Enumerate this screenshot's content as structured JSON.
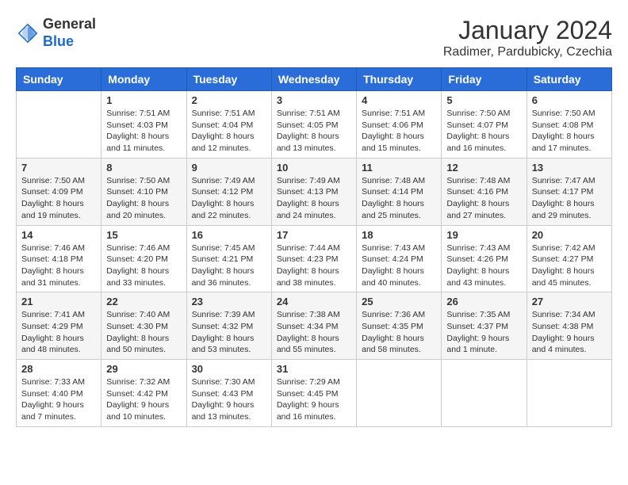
{
  "header": {
    "logo": {
      "line1": "General",
      "line2": "Blue"
    },
    "month_year": "January 2024",
    "location": "Radimer, Pardubicky, Czechia"
  },
  "days_of_week": [
    "Sunday",
    "Monday",
    "Tuesday",
    "Wednesday",
    "Thursday",
    "Friday",
    "Saturday"
  ],
  "weeks": [
    [
      {
        "day": "",
        "info": ""
      },
      {
        "day": "1",
        "info": "Sunrise: 7:51 AM\nSunset: 4:03 PM\nDaylight: 8 hours\nand 11 minutes."
      },
      {
        "day": "2",
        "info": "Sunrise: 7:51 AM\nSunset: 4:04 PM\nDaylight: 8 hours\nand 12 minutes."
      },
      {
        "day": "3",
        "info": "Sunrise: 7:51 AM\nSunset: 4:05 PM\nDaylight: 8 hours\nand 13 minutes."
      },
      {
        "day": "4",
        "info": "Sunrise: 7:51 AM\nSunset: 4:06 PM\nDaylight: 8 hours\nand 15 minutes."
      },
      {
        "day": "5",
        "info": "Sunrise: 7:50 AM\nSunset: 4:07 PM\nDaylight: 8 hours\nand 16 minutes."
      },
      {
        "day": "6",
        "info": "Sunrise: 7:50 AM\nSunset: 4:08 PM\nDaylight: 8 hours\nand 17 minutes."
      }
    ],
    [
      {
        "day": "7",
        "info": "Sunrise: 7:50 AM\nSunset: 4:09 PM\nDaylight: 8 hours\nand 19 minutes."
      },
      {
        "day": "8",
        "info": "Sunrise: 7:50 AM\nSunset: 4:10 PM\nDaylight: 8 hours\nand 20 minutes."
      },
      {
        "day": "9",
        "info": "Sunrise: 7:49 AM\nSunset: 4:12 PM\nDaylight: 8 hours\nand 22 minutes."
      },
      {
        "day": "10",
        "info": "Sunrise: 7:49 AM\nSunset: 4:13 PM\nDaylight: 8 hours\nand 24 minutes."
      },
      {
        "day": "11",
        "info": "Sunrise: 7:48 AM\nSunset: 4:14 PM\nDaylight: 8 hours\nand 25 minutes."
      },
      {
        "day": "12",
        "info": "Sunrise: 7:48 AM\nSunset: 4:16 PM\nDaylight: 8 hours\nand 27 minutes."
      },
      {
        "day": "13",
        "info": "Sunrise: 7:47 AM\nSunset: 4:17 PM\nDaylight: 8 hours\nand 29 minutes."
      }
    ],
    [
      {
        "day": "14",
        "info": "Sunrise: 7:46 AM\nSunset: 4:18 PM\nDaylight: 8 hours\nand 31 minutes."
      },
      {
        "day": "15",
        "info": "Sunrise: 7:46 AM\nSunset: 4:20 PM\nDaylight: 8 hours\nand 33 minutes."
      },
      {
        "day": "16",
        "info": "Sunrise: 7:45 AM\nSunset: 4:21 PM\nDaylight: 8 hours\nand 36 minutes."
      },
      {
        "day": "17",
        "info": "Sunrise: 7:44 AM\nSunset: 4:23 PM\nDaylight: 8 hours\nand 38 minutes."
      },
      {
        "day": "18",
        "info": "Sunrise: 7:43 AM\nSunset: 4:24 PM\nDaylight: 8 hours\nand 40 minutes."
      },
      {
        "day": "19",
        "info": "Sunrise: 7:43 AM\nSunset: 4:26 PM\nDaylight: 8 hours\nand 43 minutes."
      },
      {
        "day": "20",
        "info": "Sunrise: 7:42 AM\nSunset: 4:27 PM\nDaylight: 8 hours\nand 45 minutes."
      }
    ],
    [
      {
        "day": "21",
        "info": "Sunrise: 7:41 AM\nSunset: 4:29 PM\nDaylight: 8 hours\nand 48 minutes."
      },
      {
        "day": "22",
        "info": "Sunrise: 7:40 AM\nSunset: 4:30 PM\nDaylight: 8 hours\nand 50 minutes."
      },
      {
        "day": "23",
        "info": "Sunrise: 7:39 AM\nSunset: 4:32 PM\nDaylight: 8 hours\nand 53 minutes."
      },
      {
        "day": "24",
        "info": "Sunrise: 7:38 AM\nSunset: 4:34 PM\nDaylight: 8 hours\nand 55 minutes."
      },
      {
        "day": "25",
        "info": "Sunrise: 7:36 AM\nSunset: 4:35 PM\nDaylight: 8 hours\nand 58 minutes."
      },
      {
        "day": "26",
        "info": "Sunrise: 7:35 AM\nSunset: 4:37 PM\nDaylight: 9 hours\nand 1 minute."
      },
      {
        "day": "27",
        "info": "Sunrise: 7:34 AM\nSunset: 4:38 PM\nDaylight: 9 hours\nand 4 minutes."
      }
    ],
    [
      {
        "day": "28",
        "info": "Sunrise: 7:33 AM\nSunset: 4:40 PM\nDaylight: 9 hours\nand 7 minutes."
      },
      {
        "day": "29",
        "info": "Sunrise: 7:32 AM\nSunset: 4:42 PM\nDaylight: 9 hours\nand 10 minutes."
      },
      {
        "day": "30",
        "info": "Sunrise: 7:30 AM\nSunset: 4:43 PM\nDaylight: 9 hours\nand 13 minutes."
      },
      {
        "day": "31",
        "info": "Sunrise: 7:29 AM\nSunset: 4:45 PM\nDaylight: 9 hours\nand 16 minutes."
      },
      {
        "day": "",
        "info": ""
      },
      {
        "day": "",
        "info": ""
      },
      {
        "day": "",
        "info": ""
      }
    ]
  ]
}
